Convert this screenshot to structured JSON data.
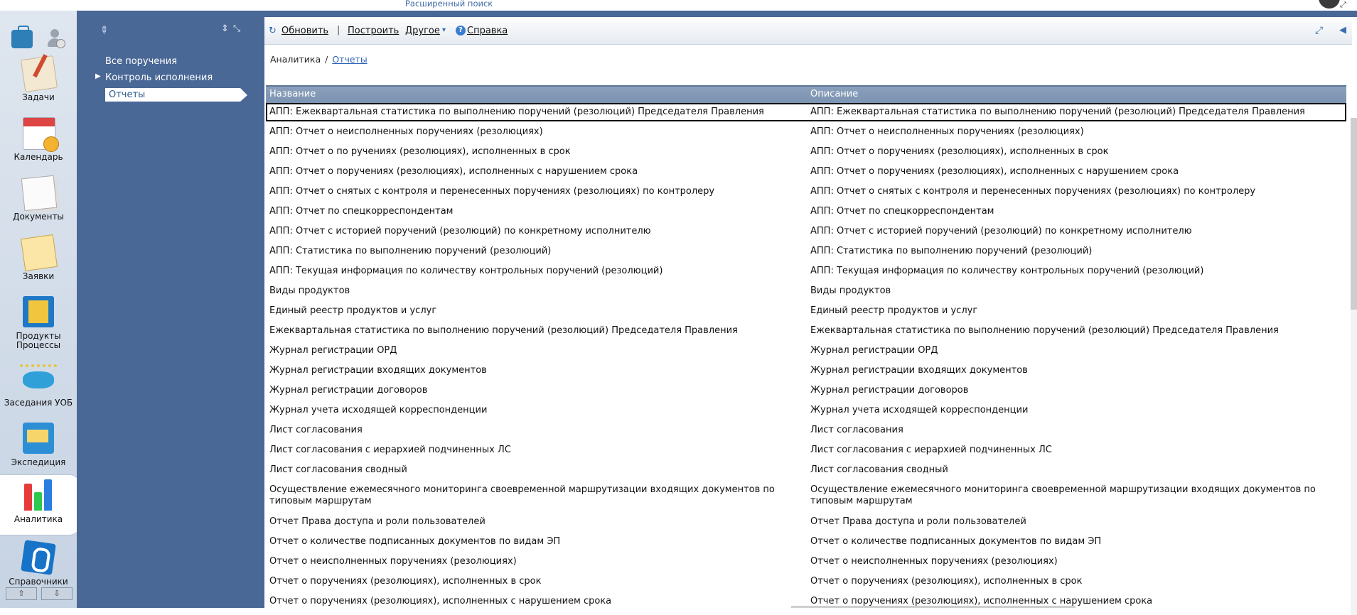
{
  "top": {
    "advanced_search": "Расширенный поиск"
  },
  "nav": {
    "items": [
      {
        "label": "Задачи",
        "icon": "tasks-icon"
      },
      {
        "label": "Календарь",
        "icon": "calendar-icon"
      },
      {
        "label": "Документы",
        "icon": "documents-icon"
      },
      {
        "label": "Заявки",
        "icon": "requests-icon"
      },
      {
        "label": "Продукты\nПроцессы",
        "icon": "products-icon"
      },
      {
        "label": "Заседания УОБ",
        "icon": "meetings-icon"
      },
      {
        "label": "Экспедиция",
        "icon": "expedition-icon"
      },
      {
        "label": "Аналитика",
        "icon": "analytics-icon",
        "active": true
      },
      {
        "label": "Справочники",
        "icon": "reference-icon"
      }
    ]
  },
  "tree": {
    "items": [
      "Все поручения",
      "Контроль исполнения",
      "Отчеты"
    ],
    "selected": "Отчеты"
  },
  "toolbar": {
    "refresh": "Обновить",
    "separator": "|",
    "build": "Построить",
    "other": "Другое",
    "other_caret": "▾",
    "help": "Справка"
  },
  "breadcrumb": {
    "root": "Аналитика",
    "sep": "/",
    "current": "Отчеты"
  },
  "grid": {
    "col_name": "Название",
    "col_desc": "Описание",
    "rows": [
      [
        "АПП: Ежеквартальная статистика по выполнению поручений (резолюций) Председателя Правления",
        "АПП: Ежеквартальная статистика по выполнению поручений (резолюций) Председателя Правления"
      ],
      [
        "АПП: Отчет о неисполненных поручениях (резолюциях)",
        "АПП: Отчет о неисполненных поручениях (резолюциях)"
      ],
      [
        "АПП: Отчет о по ручениях (резолюциях), исполненных в срок",
        "АПП: Отчет о поручениях (резолюциях), исполненных в срок"
      ],
      [
        "АПП: Отчет о поручениях (резолюциях), исполненных с нарушением срока",
        "АПП: Отчет о поручениях (резолюциях), исполненных с нарушением срока"
      ],
      [
        "АПП: Отчет о снятых с контроля и перенесенных поручениях (резолюциях) по контролеру",
        "АПП: Отчет о снятых с контроля и перенесенных поручениях (резолюциях) по контролеру"
      ],
      [
        "АПП: Отчет по спецкорреспондентам",
        "АПП: Отчет по спецкорреспондентам"
      ],
      [
        "АПП: Отчет с историей поручений (резолюций) по конкретному исполнителю",
        "АПП: Отчет с историей поручений (резолюций) по конкретному исполнителю"
      ],
      [
        "АПП: Статистика по выполнению поручений (резолюций)",
        "АПП: Статистика по выполнению поручений (резолюций)"
      ],
      [
        "АПП: Текущая информация по количеству контрольных поручений (резолюций)",
        "АПП: Текущая информация по количеству контрольных поручений (резолюций)"
      ],
      [
        "Виды продуктов",
        "Виды продуктов"
      ],
      [
        "Единый реестр продуктов и услуг",
        "Единый реестр продуктов и услуг"
      ],
      [
        "Ежеквартальная статистика по выполнению поручений (резолюций) Председателя Правления",
        "Ежеквартальная статистика по выполнению поручений (резолюций) Председателя Правления"
      ],
      [
        "Журнал регистрации ОРД",
        "Журнал регистрации ОРД"
      ],
      [
        "Журнал регистрации входящих документов",
        "Журнал регистрации входящих документов"
      ],
      [
        "Журнал регистрации договоров",
        "Журнал регистрации договоров"
      ],
      [
        "Журнал учета исходящей корреспонденции",
        "Журнал учета исходящей корреспонденции"
      ],
      [
        "Лист согласования",
        "Лист согласования"
      ],
      [
        "Лист согласования с иерархией подчиненных ЛС",
        "Лист согласования с иерархией подчиненных ЛС"
      ],
      [
        "Лист согласования сводный",
        "Лист согласования сводный"
      ],
      [
        "Осуществление ежемесячного мониторинга своевременной маршрутизации входящих документов по типовым маршрутам",
        "Осуществление ежемесячного мониторинга своевременной маршрутизации входящих документов по типовым маршрутам"
      ],
      [
        "Отчет Права доступа и роли пользователей",
        "Отчет Права доступа и роли пользователей"
      ],
      [
        "Отчет о количестве подписанных документов по видам ЭП",
        "Отчет о количестве подписанных документов по видам ЭП"
      ],
      [
        "Отчет о неисполненных поручениях (резолюциях)",
        "Отчет о неисполненных поручениях (резолюциях)"
      ],
      [
        "Отчет о поручениях (резолюциях), исполненных в срок",
        "Отчет о поручениях (резолюциях), исполненных в срок"
      ],
      [
        "Отчет о поручениях (резолюциях), исполненных с нарушением срока",
        "Отчет о поручениях (резолюциях), исполненных с нарушением срока"
      ]
    ]
  }
}
